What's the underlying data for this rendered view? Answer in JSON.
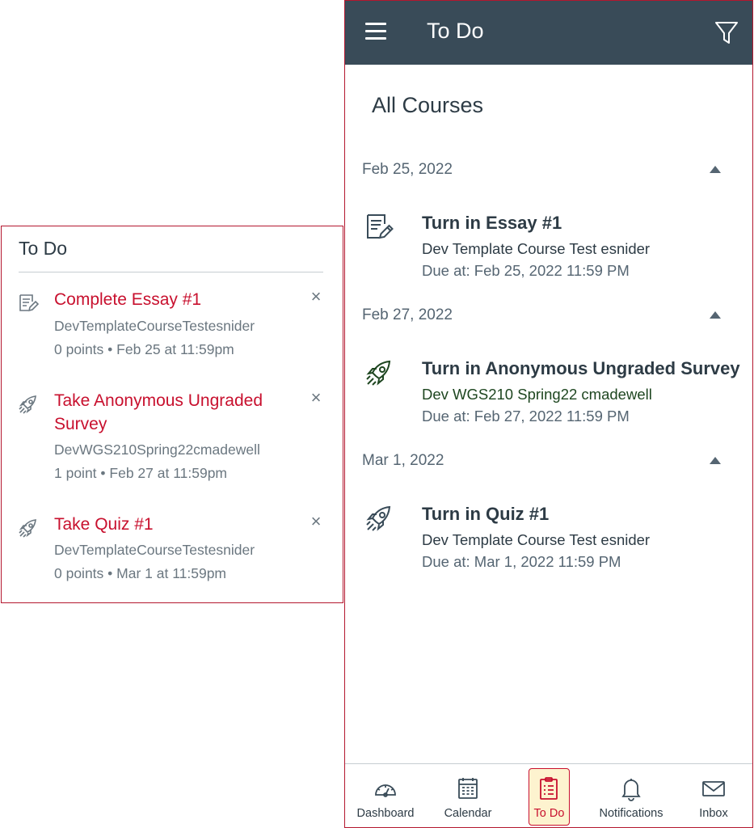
{
  "left_panel": {
    "title": "To Do",
    "items": [
      {
        "icon": "assignment-icon",
        "title": "Complete Essay #1",
        "course": "DevTemplateCourseTestesnider",
        "meta": "0 points • Feb 25 at 11:59pm",
        "dismiss_label": "×"
      },
      {
        "icon": "rocket-icon",
        "title": "Take Anonymous Ungraded Survey",
        "course": "DevWGS210Spring22cmadewell",
        "meta": "1 point • Feb 27 at 11:59pm",
        "dismiss_label": "×"
      },
      {
        "icon": "rocket-icon",
        "title": "Take Quiz #1",
        "course": "DevTemplateCourseTestesnider",
        "meta": "0 points • Mar 1 at 11:59pm",
        "dismiss_label": "×"
      }
    ]
  },
  "app": {
    "header": {
      "menu_icon": "hamburger-icon",
      "title": "To Do",
      "filter_icon": "filter-icon"
    },
    "course_heading": "All Courses",
    "groups": [
      {
        "date": "Feb 25, 2022",
        "items": [
          {
            "icon": "assignment-icon",
            "title": "Turn in Essay #1",
            "course": "Dev Template Course Test esnider",
            "course_color": "#2d3b45",
            "due": "Due at: Feb 25, 2022 11:59 PM"
          }
        ]
      },
      {
        "date": "Feb 27, 2022",
        "items": [
          {
            "icon": "rocket-icon",
            "title": "Turn in Anonymous Ungraded Survey",
            "course": "Dev WGS210 Spring22 cmadewell",
            "course_color": "#1e4620",
            "due": "Due at: Feb 27, 2022 11:59 PM"
          }
        ]
      },
      {
        "date": "Mar 1, 2022",
        "items": [
          {
            "icon": "rocket-icon",
            "title": "Turn in Quiz #1",
            "course": "Dev Template Course Test esnider",
            "course_color": "#2d3b45",
            "due": "Due at: Mar 1, 2022 11:59 PM"
          }
        ]
      }
    ],
    "bottom_nav": [
      {
        "label": "Dashboard",
        "icon": "dashboard-icon",
        "active": false
      },
      {
        "label": "Calendar",
        "icon": "calendar-icon",
        "active": false
      },
      {
        "label": "To Do",
        "icon": "todo-icon",
        "active": true
      },
      {
        "label": "Notifications",
        "icon": "bell-icon",
        "active": false
      },
      {
        "label": "Inbox",
        "icon": "mail-icon",
        "active": false
      }
    ]
  },
  "colors": {
    "accent": "#c8102e",
    "header_bg": "#394b58",
    "panel_border": "#b4172f",
    "text_primary": "#2d3b45",
    "text_secondary": "#556572",
    "active_tab_bg": "#fdf3cf"
  }
}
